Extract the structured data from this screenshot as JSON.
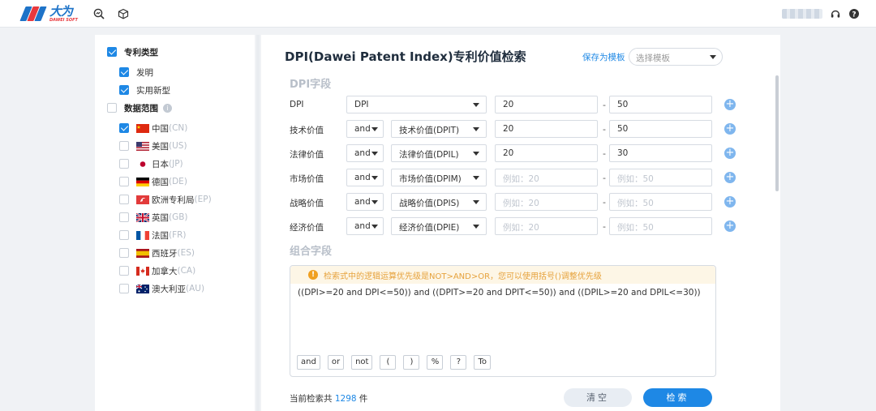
{
  "header": {
    "logo_cn": "大为",
    "logo_en": "DAWEI SOFT",
    "icons": [
      "search-analytics-icon",
      "cube-icon",
      "headset-icon",
      "help-icon"
    ]
  },
  "sidebar": {
    "patent_type": {
      "label": "专利类型",
      "checked": true,
      "items": [
        {
          "label": "发明",
          "checked": true
        },
        {
          "label": "实用新型",
          "checked": true
        }
      ]
    },
    "data_scope": {
      "label": "数据范围",
      "checked": false,
      "countries": [
        {
          "name": "中国",
          "code": "(CN)",
          "checked": true
        },
        {
          "name": "美国",
          "code": "(US)",
          "checked": false
        },
        {
          "name": "日本",
          "code": "(JP)",
          "checked": false
        },
        {
          "name": "德国",
          "code": "(DE)",
          "checked": false
        },
        {
          "name": "欧洲专利局",
          "code": "(EP)",
          "checked": false
        },
        {
          "name": "英国",
          "code": "(GB)",
          "checked": false
        },
        {
          "name": "法国",
          "code": "(FR)",
          "checked": false
        },
        {
          "name": "西班牙",
          "code": "(ES)",
          "checked": false
        },
        {
          "name": "加拿大",
          "code": "(CA)",
          "checked": false
        },
        {
          "name": "澳大利亚",
          "code": "(AU)",
          "checked": false
        }
      ]
    }
  },
  "main": {
    "title": "DPI(Dawei Patent Index)专利价值检索",
    "save_template": "保存为模板",
    "template_placeholder": "选择模板",
    "dpi_section_title": "DPI字段",
    "rows": [
      {
        "label": "DPI",
        "op": "",
        "field": "DPI",
        "min": "20",
        "max": "50"
      },
      {
        "label": "技术价值",
        "op": "and",
        "field": "技术价值(DPIT)",
        "min": "20",
        "max": "50"
      },
      {
        "label": "法律价值",
        "op": "and",
        "field": "法律价值(DPIL)",
        "min": "20",
        "max": "30"
      },
      {
        "label": "市场价值",
        "op": "and",
        "field": "市场价值(DPIM)",
        "min": "",
        "max": "",
        "min_placeholder": "例如：20",
        "max_placeholder": "例如：50"
      },
      {
        "label": "战略价值",
        "op": "and",
        "field": "战略价值(DPIS)",
        "min": "",
        "max": "",
        "min_placeholder": "例如：20",
        "max_placeholder": "例如：50"
      },
      {
        "label": "经济价值",
        "op": "and",
        "field": "经济价值(DPIE)",
        "min": "",
        "max": "",
        "min_placeholder": "例如：20",
        "max_placeholder": "例如：50"
      }
    ],
    "range_sep": "-",
    "combo_section_title": "组合字段",
    "warning": "检索式中的逻辑运算优先级是NOT>AND>OR，您可以使用括号()调整优先级",
    "expression": "((DPI>=20 and DPI<=50)) and ((DPIT>=20 and DPIT<=50)) and ((DPIL>=20 and DPIL<=30))",
    "operators": [
      "and",
      "or",
      "not",
      "(",
      ")",
      "%",
      "?",
      "To"
    ],
    "result_prefix": "当前检索共",
    "result_count": "1298",
    "result_suffix": "件",
    "clear_label": "清空",
    "search_label": "检索"
  },
  "colors": {
    "accent": "#1e88e5",
    "warning": "#e6a23c",
    "section_title": "#b8bfc9"
  }
}
